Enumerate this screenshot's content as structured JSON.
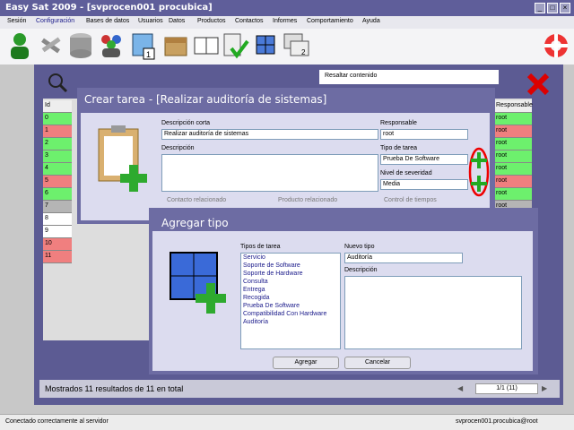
{
  "window": {
    "title": "Easy Sat 2009 - [svprocen001 procubica]"
  },
  "menu": [
    "Sesión",
    "Configuración",
    "Bases de datos",
    "Usuarios",
    "Datos",
    "Productos",
    "Contactos",
    "Informes",
    "Comportamiento",
    "Ayuda"
  ],
  "toolbar": {
    "icons": [
      "user-icon",
      "tools-icon",
      "database-icon",
      "users-icon",
      "calendar-icon",
      "box-icon",
      "book-icon",
      "checklist-icon",
      "cube-icon",
      "windows-icon",
      "lifebuoy-icon"
    ]
  },
  "search": {
    "text": "Resaltar contenido"
  },
  "grid": {
    "header_left": "Id",
    "header_right": "Responsable",
    "ids": [
      "0",
      "1",
      "2",
      "3",
      "4",
      "5",
      "6",
      "7",
      "8",
      "9",
      "10",
      "11"
    ],
    "responsables": [
      "root",
      "root",
      "root",
      "root",
      "root",
      "root",
      "root",
      "root",
      "",
      "",
      "",
      ""
    ],
    "colors": {
      "green": "#6df06d",
      "red": "#f07f7f",
      "gray": "#b5b5b5",
      "white": "#ffffff"
    }
  },
  "dialog_task": {
    "title": "Crear tarea - [Realizar auditoría de sistemas]",
    "short_desc_label": "Descripción corta",
    "short_desc_value": "Realizar auditoría de sistemas",
    "desc_label": "Descripción",
    "responsable_label": "Responsable",
    "responsable_value": "root",
    "tipo_label": "Tipo de tarea",
    "tipo_value": "Prueba De Software",
    "sev_label": "Nivel de severidad",
    "sev_value": "Media",
    "contacto_label": "Contacto relacionado",
    "producto_label": "Producto relacionado",
    "control_label": "Control de tiempos"
  },
  "dialog_type": {
    "title": "Agregar tipo",
    "types_label": "Tipos de tarea",
    "types": [
      "Servicio",
      "Soporte de Software",
      "Soporte de Hardware",
      "Consulta",
      "Entrega",
      "Recogida",
      "Prueba De Software",
      "Compatibilidad Con Hardware",
      "Auditoría"
    ],
    "new_label": "Nuevo tipo",
    "new_value": "Auditoría",
    "desc_label": "Descripción",
    "add_button": "Agregar",
    "cancel_button": "Cancelar"
  },
  "footer": {
    "results": "Mostrados 11 resultados de 11 en total",
    "page": "1/1 (11)"
  },
  "status": {
    "left": "Conectado correctamente al servidor",
    "right": "svprocen001.procubica@root"
  }
}
